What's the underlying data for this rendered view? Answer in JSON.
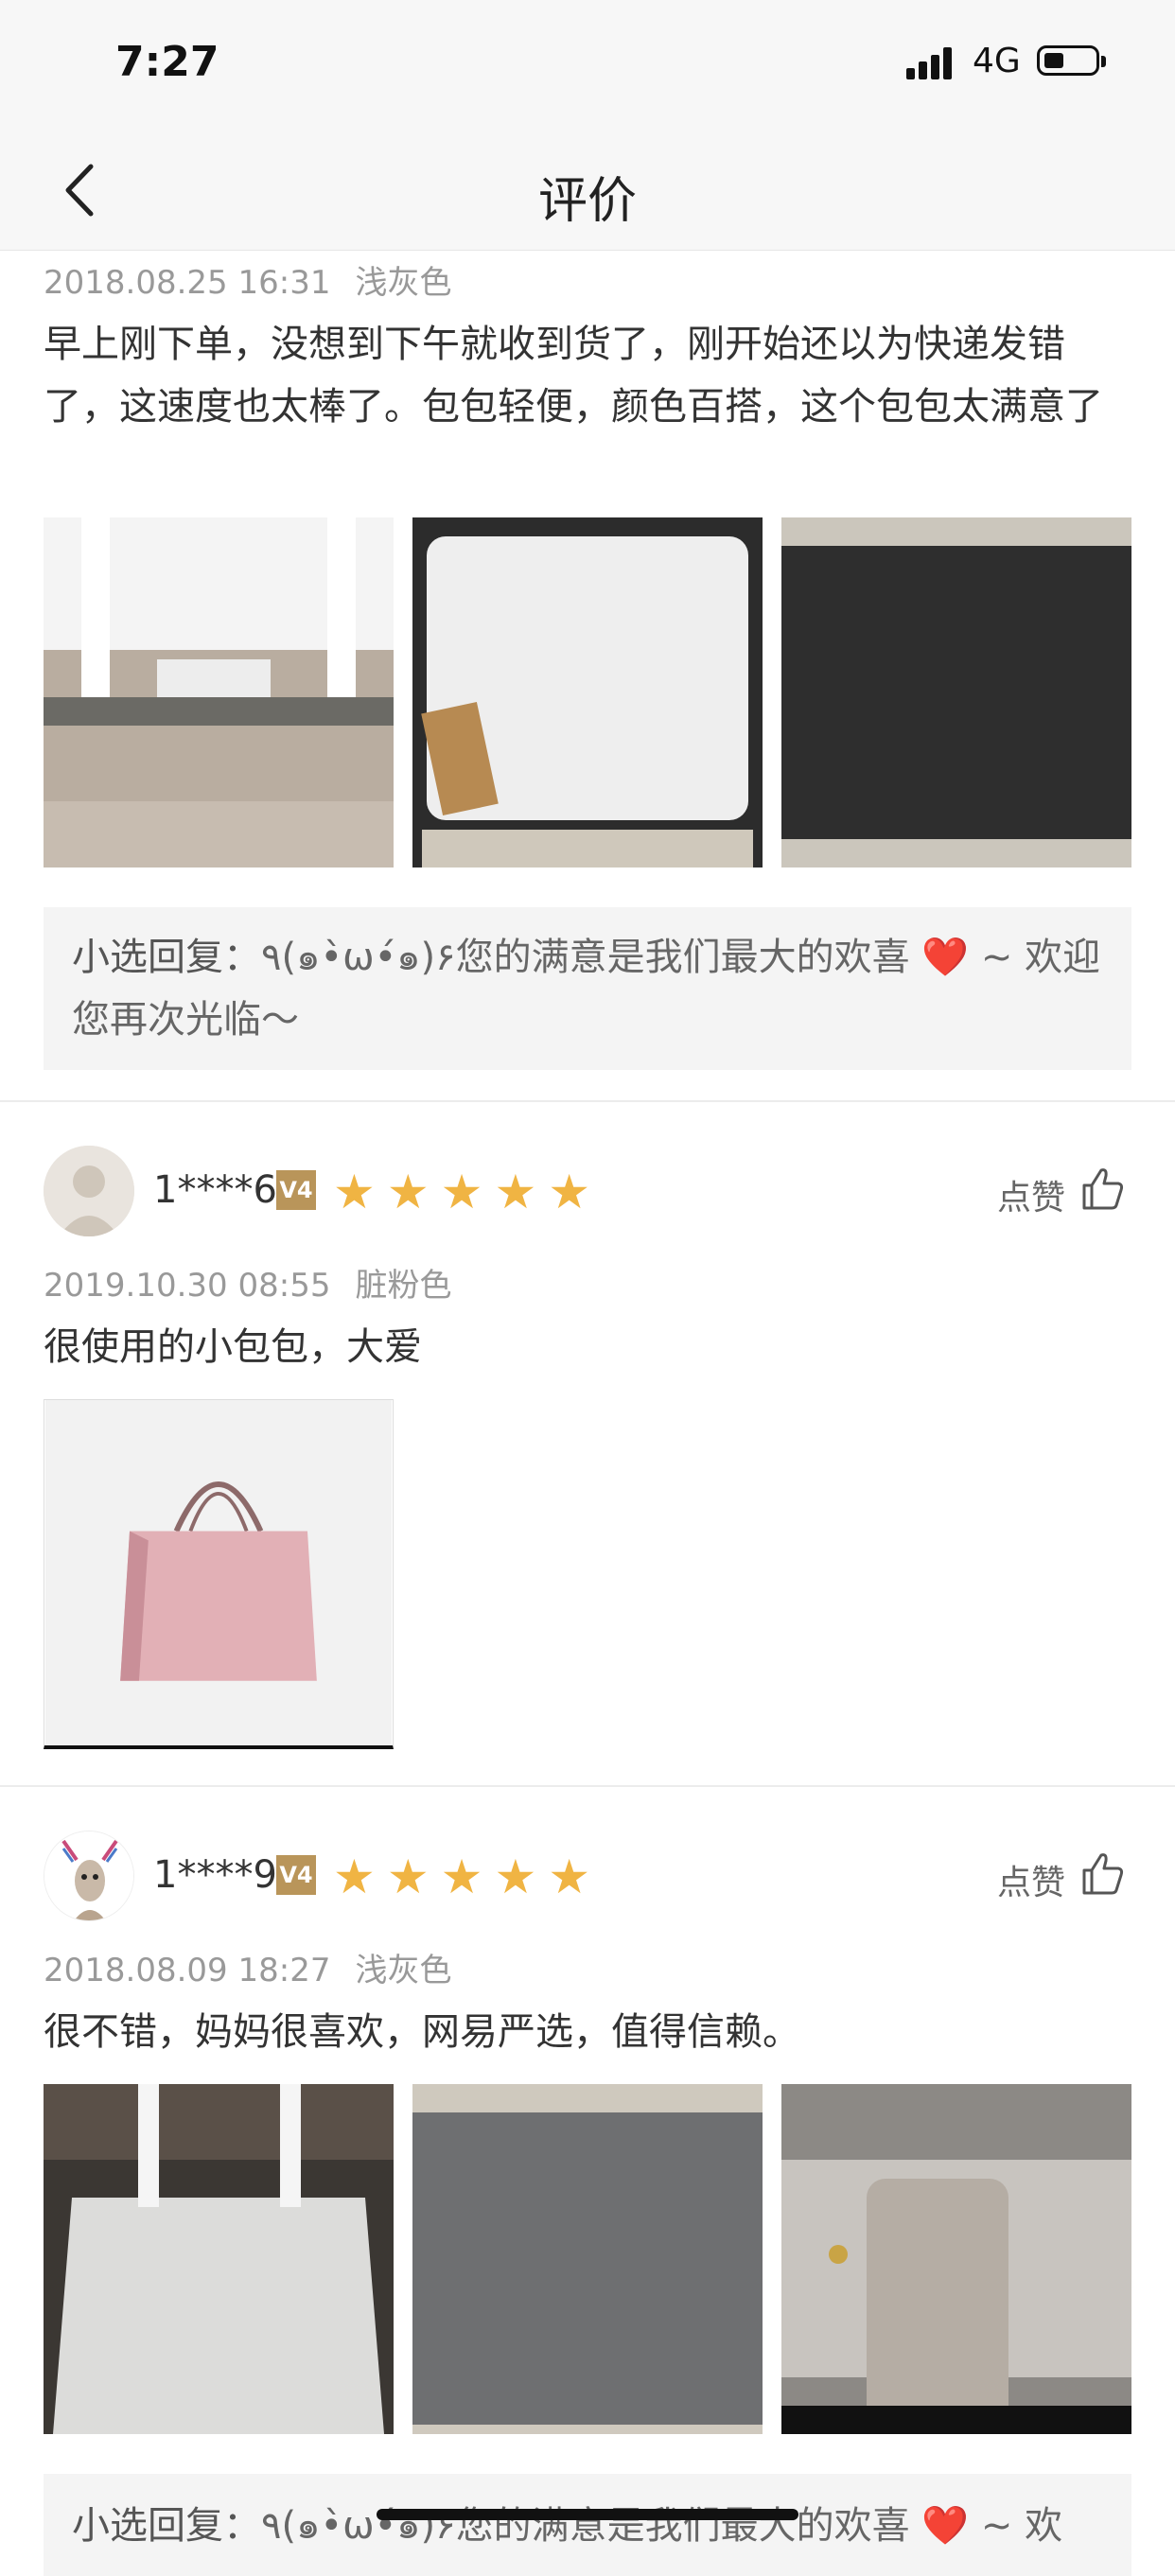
{
  "status_bar": {
    "time": "7:27",
    "network": "4G"
  },
  "nav": {
    "title": "评价"
  },
  "review_top": {
    "date": "2018.08.25 16:31",
    "spec": "浅灰色",
    "text": "早上刚下单，没想到下午就收到货了，刚开始还以为快递发错了，这速度也太棒了。包包轻便，颜色百搭，这个包包太满意了",
    "reply_label": "小选回复：",
    "reply_text": "٩(๑•̀ω•́๑)۶您的满意是我们最大的欢喜 ❤️ ~ 欢迎您再次光临～"
  },
  "review_2": {
    "user": "1****6",
    "vip_level": "V4",
    "stars": "★★★★★",
    "like_label": "点赞",
    "date": "2019.10.30 08:55",
    "spec": "脏粉色",
    "text": "很使用的小包包，大爱"
  },
  "review_3": {
    "user": "1****9",
    "vip_level": "V4",
    "stars": "★★★★★",
    "like_label": "点赞",
    "date": "2018.08.09 18:27",
    "spec": "浅灰色",
    "text": "很不错，妈妈很喜欢，网易严选，值得信赖。",
    "reply_label": "小选回复：",
    "reply_text": "٩(๑•̀ω•́๑)۶您的满意是我们最大的欢喜 ❤️ ~ 欢"
  },
  "colors": {
    "star": "#f0b443",
    "vip_badge": "#b9955a",
    "reply_bg": "#f4f4f4"
  }
}
